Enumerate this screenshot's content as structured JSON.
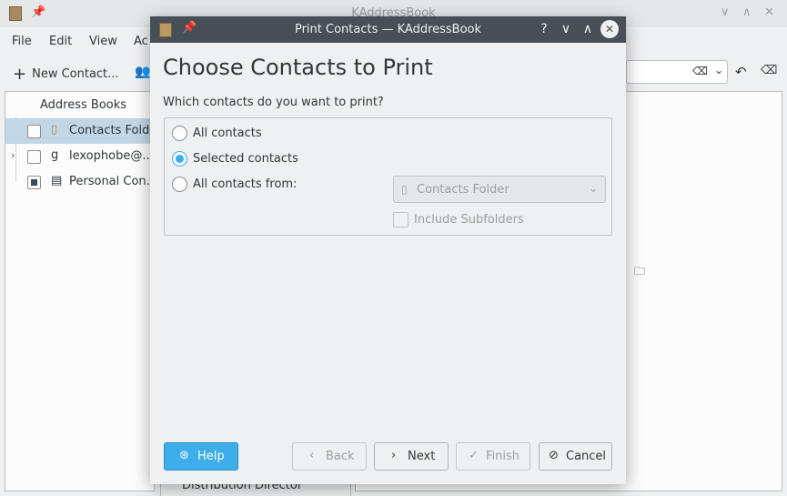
{
  "background_window": {
    "title": "KAddressBook",
    "menu": [
      "File",
      "Edit",
      "View",
      "Ac"
    ],
    "toolbar": {
      "new_contact_label": "New Contact..."
    },
    "left_panel": {
      "header": "Address Books",
      "items": [
        {
          "label": "Contacts Fold...",
          "checked": false,
          "selected": true
        },
        {
          "label": "lexophobe@...",
          "checked": false,
          "selected": false
        },
        {
          "label": "Personal Con...",
          "checked": "partial",
          "selected": false
        }
      ]
    },
    "list_item_partial": "Distribution Director"
  },
  "dialog": {
    "title": "Print Contacts — KAddressBook",
    "heading": "Choose Contacts to Print",
    "question": "Which contacts do you want to print?",
    "options": [
      {
        "label": "All contacts",
        "checked": false
      },
      {
        "label": "Selected contacts",
        "checked": true
      },
      {
        "label": "All contacts from:",
        "checked": false
      }
    ],
    "folder_combo": {
      "value": "Contacts Folder",
      "enabled": false
    },
    "include_subfolders": {
      "label": "Include Subfolders",
      "checked": false,
      "enabled": false
    },
    "buttons": {
      "help": "Help",
      "back": "Back",
      "next": "Next",
      "finish": "Finish",
      "cancel": "Cancel"
    }
  },
  "colors": {
    "accent": "#3daee9",
    "titlebar": "#475057",
    "window_bg": "#eff0f1",
    "disabled_text": "#9aa0a4"
  }
}
